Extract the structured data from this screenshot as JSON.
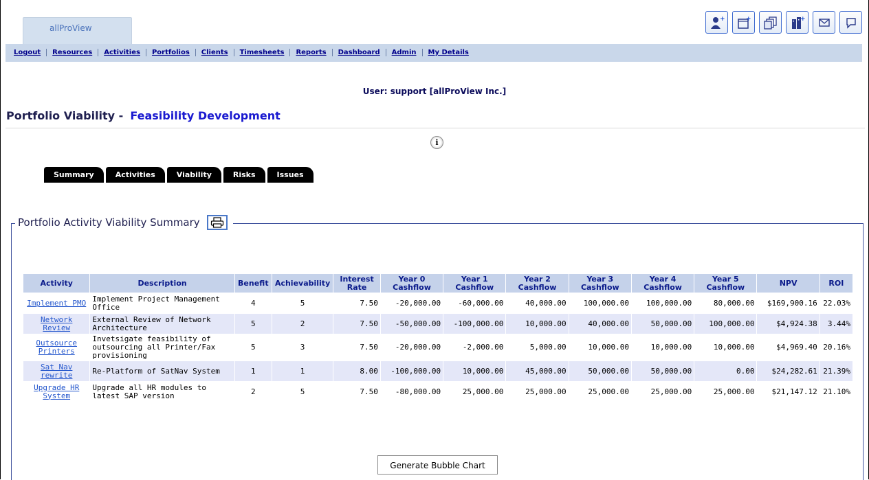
{
  "app": {
    "tab_label": "allProView"
  },
  "toolbar_icons": [
    "add-user-icon",
    "new-item-icon",
    "copy-documents-icon",
    "add-building-icon",
    "mail-icon",
    "chat-icon"
  ],
  "nav": {
    "items": [
      "Logout",
      "Resources",
      "Activities",
      "Portfolios",
      "Clients",
      "Timesheets",
      "Reports",
      "Dashboard",
      "Admin",
      "My Details"
    ]
  },
  "user_line": "User: support  [allProView Inc.]",
  "page": {
    "title": "Portfolio Viability -",
    "subtitle": "Feasibility Development"
  },
  "subtabs": [
    "Summary",
    "Activities",
    "Viability",
    "Risks",
    "Issues"
  ],
  "section": {
    "title": "Portfolio Activity Viability Summary"
  },
  "table": {
    "headers": [
      "Activity",
      "Description",
      "Benefit",
      "Achievability",
      "Interest Rate",
      "Year 0 Cashflow",
      "Year 1 Cashflow",
      "Year 2 Cashflow",
      "Year 3 Cashflow",
      "Year 4 Cashflow",
      "Year 5 Cashflow",
      "NPV",
      "ROI"
    ],
    "rows": [
      [
        "Implement PMO",
        "Implement Project Management Office",
        "4",
        "5",
        "7.50",
        "-20,000.00",
        "-60,000.00",
        "40,000.00",
        "100,000.00",
        "100,000.00",
        "80,000.00",
        "$169,900.16",
        "22.03%"
      ],
      [
        "Network Review",
        "External Review of Network Architecture",
        "5",
        "2",
        "7.50",
        "-50,000.00",
        "-100,000.00",
        "10,000.00",
        "40,000.00",
        "50,000.00",
        "100,000.00",
        "$4,924.38",
        "3.44%"
      ],
      [
        "Outsource Printers",
        "Invetsigate feasibility of outsourcing all Printer/Fax provisioning",
        "5",
        "3",
        "7.50",
        "-20,000.00",
        "-2,000.00",
        "5,000.00",
        "10,000.00",
        "10,000.00",
        "10,000.00",
        "$4,969.40",
        "20.16%"
      ],
      [
        "Sat Nav rewrite",
        "Re-Platform of SatNav System",
        "1",
        "1",
        "8.00",
        "-100,000.00",
        "10,000.00",
        "45,000.00",
        "50,000.00",
        "50,000.00",
        "0.00",
        "$24,282.61",
        "21.39%"
      ],
      [
        "Upgrade HR System",
        "Upgrade all HR modules to latest SAP version",
        "2",
        "5",
        "7.50",
        "-80,000.00",
        "25,000.00",
        "25,000.00",
        "25,000.00",
        "25,000.00",
        "25,000.00",
        "$21,147.12",
        "21.10%"
      ]
    ]
  },
  "buttons": {
    "generate": "Generate Bubble Chart"
  }
}
